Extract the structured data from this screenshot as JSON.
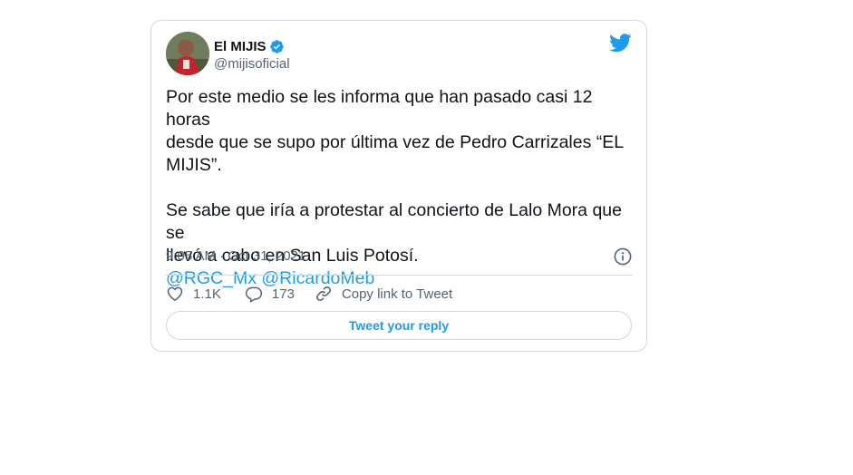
{
  "tweet": {
    "display_name": "El MIJIS",
    "handle": "@mijisoficial",
    "verified": true,
    "body": {
      "line1": "Por este medio se les informa que han pasado casi 12 horas",
      "line2": "desde que se supo por última vez de Pedro Carrizales “EL",
      "line3": "MIJIS”.",
      "line4": "Se sabe que iría a protestar al concierto de Lalo Mora que se",
      "line5": "llevó a cabo en San Luis Potosí.",
      "mention1": "@RGC_Mx",
      "mention2": "@RicardoMeb"
    },
    "timestamp": "9:05 AM · Oct 31, 2021",
    "likes": "1.1K",
    "replies": "173",
    "copy_link_label": "Copy link to Tweet",
    "reply_button_label": "Tweet your reply"
  },
  "colors": {
    "accent": "#1d9bf0",
    "text": "#0f1419",
    "secondary": "#536471",
    "border": "#cfd9de"
  },
  "icons": [
    "verified-icon",
    "twitter-logo-icon",
    "info-icon",
    "heart-icon",
    "reply-bubble-icon",
    "link-icon"
  ]
}
